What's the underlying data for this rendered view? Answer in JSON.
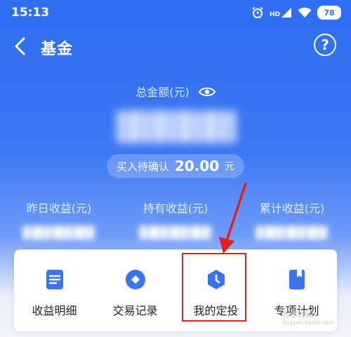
{
  "status_bar": {
    "time": "15:13",
    "signal_tag": "HD",
    "battery": "78"
  },
  "header": {
    "title": "基金",
    "help": "?"
  },
  "summary": {
    "total_label": "总金额(元)",
    "pending_label": "买入待确认",
    "pending_value": "20.00",
    "pending_unit": "元"
  },
  "stats": [
    {
      "label": "昨日收益(元)"
    },
    {
      "label": "持有收益(元)"
    },
    {
      "label": "累计收益(元)"
    }
  ],
  "actions": [
    {
      "label": "收益明细",
      "icon": "document-icon"
    },
    {
      "label": "交易记录",
      "icon": "diamond-circle-icon"
    },
    {
      "label": "我的定投",
      "icon": "clock-shield-icon"
    },
    {
      "label": "专项计划",
      "icon": "bookmark-icon"
    }
  ],
  "watermark": {
    "zh": "百度经验",
    "en": "jingyan.baidu.com"
  },
  "colors": {
    "accent": "#3a73f3",
    "highlight": "#e0201c"
  }
}
